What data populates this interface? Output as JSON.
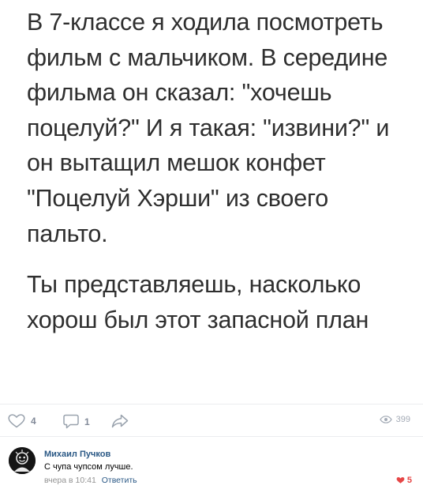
{
  "post": {
    "paragraphs": [
      "В 7-классе я ходила посмотреть фильм с мальчиком. В середине фильма он сказал: \"хочешь поцелуй?\" И я такая: \"извини?\" и он вытащил мешок конфет \"Поцелуй Хэрши\" из своего пальто.",
      "Ты представляешь, насколько хорош был этот запасной план"
    ]
  },
  "actions": {
    "likes": "4",
    "comments": "1",
    "views": "399",
    "icons": {
      "like": "heart-outline-icon",
      "comment": "comment-icon",
      "share": "share-arrow-icon",
      "views": "eye-icon"
    }
  },
  "comment": {
    "author": "Михаил Пучков",
    "text": "С чупа чупсом лучше.",
    "time": "вчера в 10:41",
    "reply_label": "Ответить",
    "likes": "5",
    "like_color": "#e64646"
  }
}
